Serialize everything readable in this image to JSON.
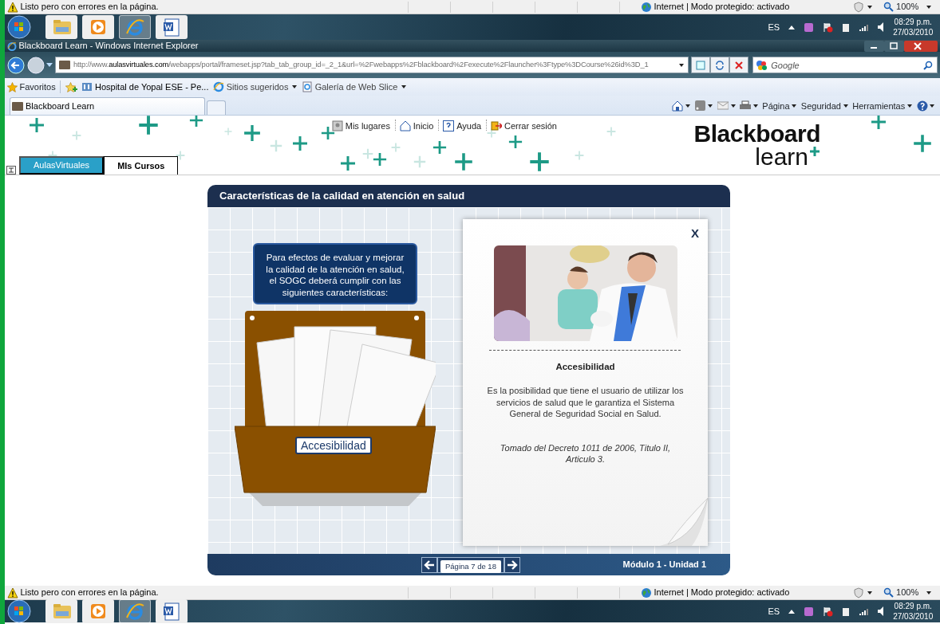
{
  "top_status_bar": {
    "message": "Listo pero con errores en la página.",
    "zone": "Internet | Modo protegido: activado",
    "zoom": "100%"
  },
  "top_taskbar": {
    "apps": [
      {
        "kind": "folder",
        "selected": false
      },
      {
        "kind": "media",
        "selected": false
      },
      {
        "kind": "browser",
        "selected": true
      },
      {
        "kind": "word",
        "selected": false
      }
    ],
    "language": "ES",
    "time": "08:29 p.m.",
    "date": "27/03/2010"
  },
  "window": {
    "title": "Blackboard Learn - Windows Internet Explorer"
  },
  "address_bar": {
    "url": "http://www.**aulasvirtuales.com**/webapps/portal/frameset.jsp?tab_tab_group_id=_2_1&url=%2Fwebapps%2Fblackboard%2Fexecute%2Flauncher%3Ftype%3DCourse%26id%3D_1",
    "search_placeholder": "Google"
  },
  "favorites_bar": {
    "label": "Favoritos",
    "links": [
      {
        "kind": "site",
        "label": "Hospital de Yopal ESE - Pe...",
        "dropdown": false
      },
      {
        "kind": "browser",
        "label": "Sitios sugeridos",
        "dropdown": true
      },
      {
        "kind": "page",
        "label": "Galería de Web Slice",
        "dropdown": true
      }
    ]
  },
  "browser_tabs": [
    {
      "label": "Blackboard Learn",
      "selected": true
    }
  ],
  "command_bar": {
    "menus": [
      "Página",
      "Seguridad",
      "Herramientas"
    ]
  },
  "portal_header": {
    "links": [
      {
        "kind": "places",
        "label": "Mis lugares"
      },
      {
        "kind": "home",
        "label": "Inicio"
      },
      {
        "kind": "help",
        "label": "Ayuda"
      },
      {
        "kind": "logout",
        "label": "Cerrar sesión"
      }
    ],
    "logo": [
      "Blackboard",
      "learn"
    ],
    "tabs": [
      {
        "label": "AulasVirtuales",
        "selected": false
      },
      {
        "label": "MIs Cursos",
        "selected": true
      }
    ]
  },
  "lesson": {
    "title": "Características de la calidad en atención en salud",
    "instruction": "Para efectos de evaluar y mejorar la calidad de la atención en salud, el SOGC deberá cumplir con las siguientes características:",
    "box_label": "Accesibilidad",
    "panel": {
      "close": "X",
      "heading": "Accesibilidad",
      "body": "Es la posibilidad que tiene el usuario de utilizar los servicios de salud que le garantiza el Sistema General de Seguridad Social en Salud.",
      "citation": "Tomado del Decreto 1011 de 2006, Titulo II, Articulo 3."
    },
    "pager": "Página 7 de 18",
    "module": "Módulo 1 - Unidad 1"
  },
  "bottom_status_bar": {
    "message": "Listo pero con errores en la página.",
    "zone": "Internet | Modo protegido: activado",
    "zoom": "100%"
  },
  "bottom_taskbar": {
    "apps": [
      {
        "kind": "folder",
        "selected": false
      },
      {
        "kind": "media",
        "selected": false
      },
      {
        "kind": "browser",
        "selected": true
      },
      {
        "kind": "word",
        "selected": false
      }
    ],
    "language": "ES",
    "time": "08:29 p.m.",
    "date": "27/03/2010"
  }
}
